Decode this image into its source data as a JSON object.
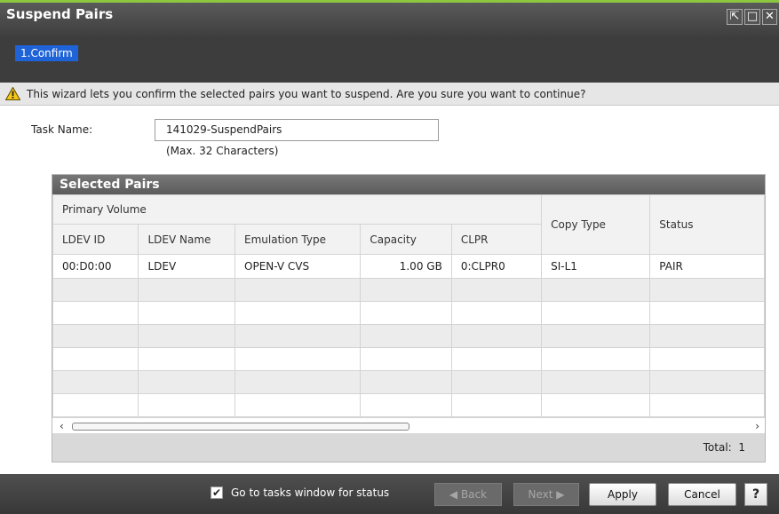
{
  "window": {
    "title": "Suspend Pairs",
    "buttons": {
      "pin": "⇱",
      "maximize": "□",
      "close": "✕"
    }
  },
  "steps": [
    {
      "label": "1.Confirm",
      "active": true
    }
  ],
  "info": {
    "icon": "warning-icon",
    "text": "This wizard lets you confirm the selected pairs you want to suspend. Are you sure you want to continue?"
  },
  "task": {
    "label": "Task Name:",
    "value": "141029-SuspendPairs",
    "hint": "(Max. 32 Characters)"
  },
  "table": {
    "title": "Selected Pairs",
    "group_header": "Primary Volume",
    "columns": [
      "LDEV ID",
      "LDEV Name",
      "Emulation Type",
      "Capacity",
      "CLPR",
      "Copy Type",
      "Status"
    ],
    "rows": [
      [
        "00:D0:00",
        "LDEV",
        "OPEN-V CVS",
        "1.00 GB",
        "0:CLPR0",
        "SI-L1",
        "PAIR"
      ]
    ],
    "empty_rows": 6,
    "scroll_left": "‹",
    "scroll_right": "›",
    "total_label": "Total:",
    "total_value": "1"
  },
  "footer": {
    "checkbox_checked": true,
    "checkbox_mark": "✔",
    "checkbox_label": "Go to tasks window for status",
    "back_label": "◀ Back",
    "next_label": "Next ▶",
    "apply_label": "Apply",
    "cancel_label": "Cancel",
    "help_label": "?"
  }
}
